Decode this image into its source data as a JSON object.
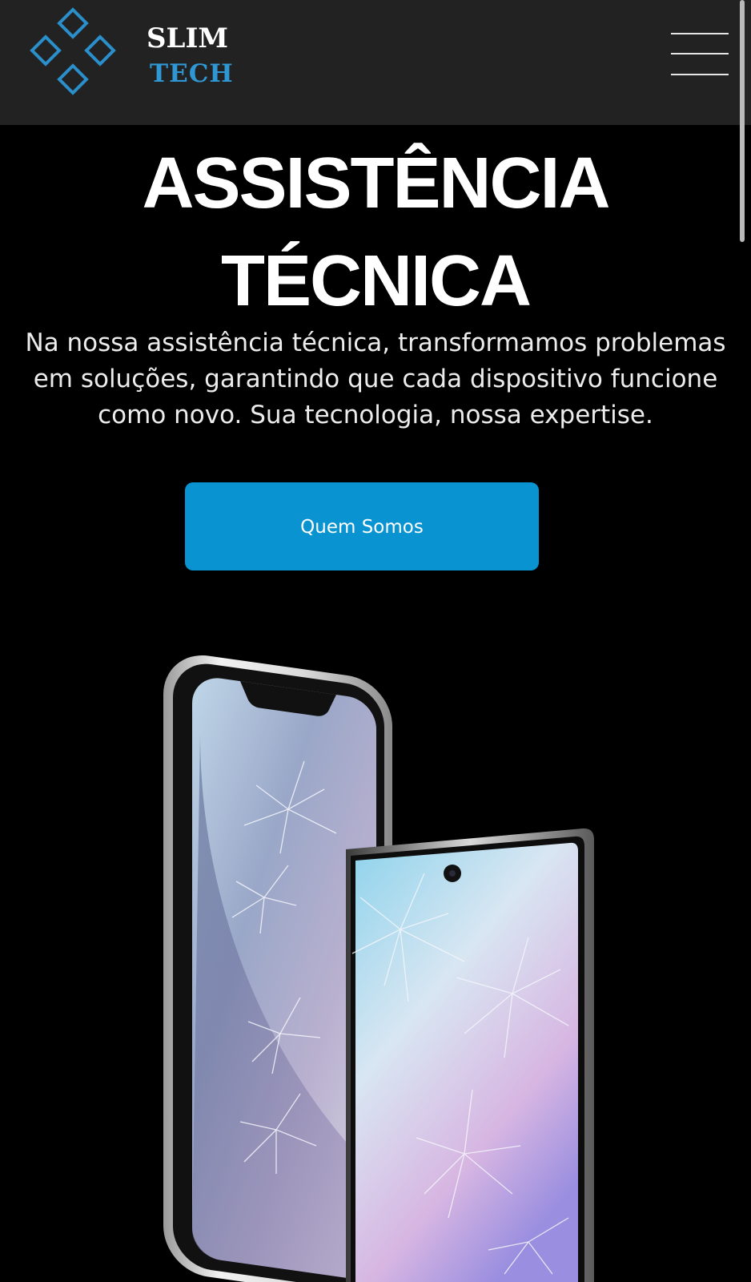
{
  "header": {
    "brand_line1": "SLIM",
    "brand_line2": "TECH",
    "logo_icon": "diamond-cluster-logo",
    "menu_icon": "hamburger-menu-icon"
  },
  "hero": {
    "title_line1": "ASSISTÊNCIA",
    "title_line2": "TÉCNICA",
    "description": "Na nossa assistência técnica, transformamos problemas em soluções, garantindo que cada dispositivo funcione como novo. Sua tecnologia, nossa expertise.",
    "cta_label": "Quem Somos"
  },
  "colors": {
    "header_bg": "#222222",
    "page_bg": "#000000",
    "accent": "#0a93d1",
    "brand_blue": "#2f97d3"
  }
}
